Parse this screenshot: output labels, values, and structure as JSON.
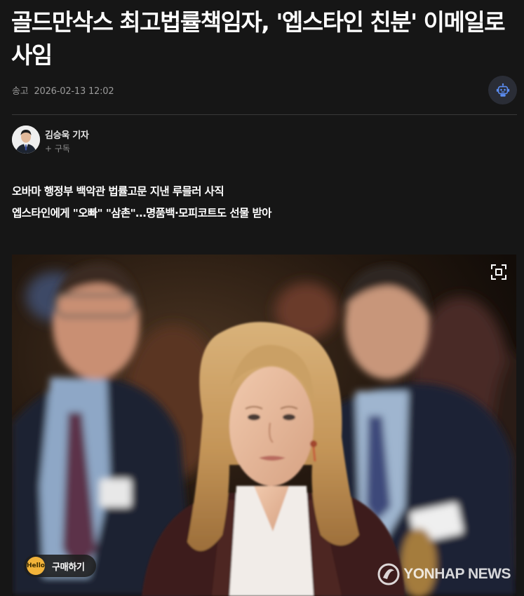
{
  "article": {
    "headline": "골드만삭스 최고법률책임자, '엡스타인 친분' 이메일로 사임",
    "sent_label": "송고",
    "timestamp": "2026-02-13 12:02",
    "ai_icon": "robot-icon"
  },
  "reporter": {
    "name": "김승욱 기자",
    "subscribe_label": "+ 구독"
  },
  "subheads": [
    "오바마 행정부 백악관 법률고문 지낸 루믈러 사직",
    "엡스타인에게 \"오빠\" \"삼촌\"…명품백·모피코트도 선물 받아"
  ],
  "photo": {
    "expand_icon": "expand-icon",
    "buy_label": "구매하기",
    "buy_icon_text": "Hello",
    "watermark": "YONHAP NEWS"
  },
  "colors": {
    "background": "#161616",
    "text": "#ffffff",
    "muted": "#9a9a9a",
    "divider": "#383838",
    "ai_button": "#2a2d36",
    "ai_icon": "#5b8cf0",
    "buy_badge": "#f2b33a"
  }
}
